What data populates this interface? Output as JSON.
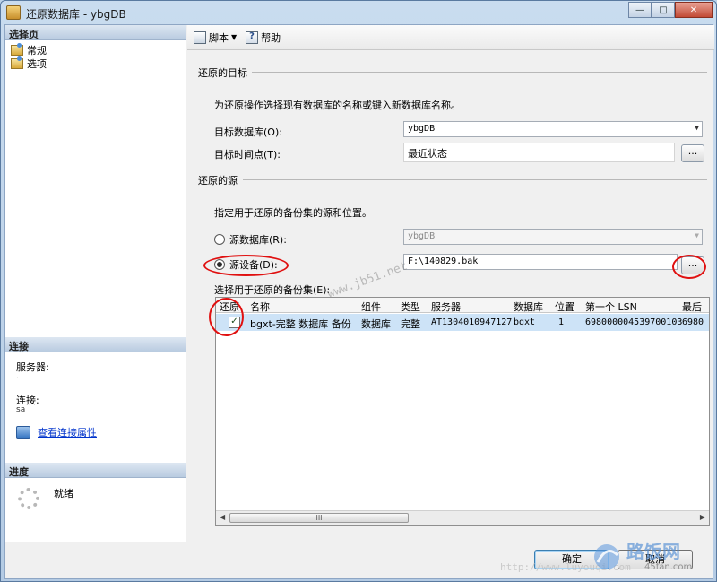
{
  "window": {
    "title": "还原数据库 - ybgDB",
    "minimize": "—",
    "maximize": "□",
    "close": "✕"
  },
  "sidebar": {
    "select_page_header": "选择页",
    "pages": [
      {
        "label": "常规"
      },
      {
        "label": "选项"
      }
    ],
    "connection_header": "连接",
    "server_label": "服务器:",
    "server_value": ".",
    "connection_label": "连接:",
    "connection_value": "sa",
    "view_connection_link": "查看连接属性",
    "progress_header": "进度",
    "progress_status": "就绪"
  },
  "toolbar": {
    "script_label": "脚本",
    "script_arrow": "▼",
    "help_label": "帮助"
  },
  "restore_target": {
    "group_title": "还原的目标",
    "description": "为还原操作选择现有数据库的名称或键入新数据库名称。",
    "target_db_label": "目标数据库(O):",
    "target_db_value": "ybgDB",
    "target_time_label": "目标时间点(T):",
    "target_time_value": "最近状态",
    "browse_label": "..."
  },
  "restore_source": {
    "group_title": "还原的源",
    "description": "指定用于还原的备份集的源和位置。",
    "source_db_label": "源数据库(R):",
    "source_db_value": "ybgDB",
    "source_device_label": "源设备(D):",
    "source_device_value": "F:\\140829.bak",
    "browse_label": "...",
    "source_device_selected": true
  },
  "backup_sets": {
    "label": "选择用于还原的备份集(E):",
    "columns": [
      "还原",
      "名称",
      "组件",
      "类型",
      "服务器",
      "数据库",
      "位置",
      "第一个 LSN",
      "最后"
    ],
    "rows": [
      {
        "restore": true,
        "restore_mark": "✓",
        "name": "bgxt-完整 数据库 备份",
        "component": "数据库",
        "type": "完整",
        "server": "AT1304010947127",
        "database": "bgxt",
        "position": "1",
        "first_lsn": "698000004539700103",
        "last_lsn": "6980"
      }
    ],
    "scroll_left": "◀",
    "scroll_right": "▶",
    "scroll_grip": "III"
  },
  "buttons": {
    "ok": "确定",
    "cancel": "取消"
  },
  "watermarks": {
    "diagonal": "www.jb51.net",
    "bottom": "http://www.luyouqi.com"
  },
  "logo": {
    "text": "路饭网",
    "sub": "45fan.com"
  },
  "colors": {
    "annotation": "#e01010",
    "selected_row": "#cde3f7",
    "link": "#0033cc",
    "section_header": "#b9cbe0"
  }
}
